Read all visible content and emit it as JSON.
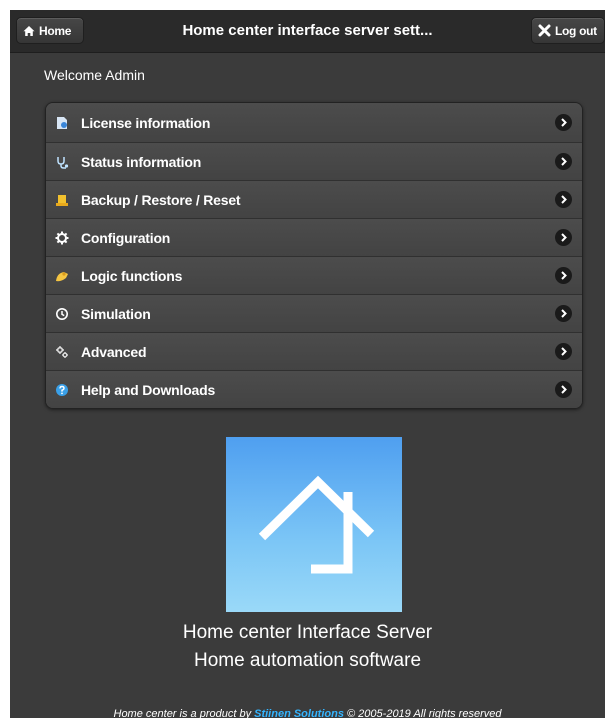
{
  "header": {
    "home_label": "Home",
    "title": "Home center interface server sett...",
    "logout_label": "Log out"
  },
  "welcome": "Welcome Admin",
  "menu": {
    "items": [
      {
        "label": "License information",
        "icon": "license-icon"
      },
      {
        "label": "Status information",
        "icon": "stethoscope-icon"
      },
      {
        "label": "Backup / Restore / Reset",
        "icon": "backup-icon"
      },
      {
        "label": "Configuration",
        "icon": "gear-icon"
      },
      {
        "label": "Logic functions",
        "icon": "logic-icon"
      },
      {
        "label": "Simulation",
        "icon": "clock-icon"
      },
      {
        "label": "Advanced",
        "icon": "gears-icon"
      },
      {
        "label": "Help and Downloads",
        "icon": "help-icon"
      }
    ]
  },
  "product": {
    "line1": "Home center Interface Server",
    "line2": "Home automation software"
  },
  "footer": {
    "prefix": "Home center is a product by ",
    "link": "Stiinen Solutions",
    "suffix": " © 2005-2019 All rights reserved"
  },
  "colors": {
    "background": "#3b3b3b",
    "header": "#2a2a2a",
    "link": "#35b5ff",
    "logo_top": "#4f9ff0",
    "logo_bottom": "#9ad9f8"
  }
}
